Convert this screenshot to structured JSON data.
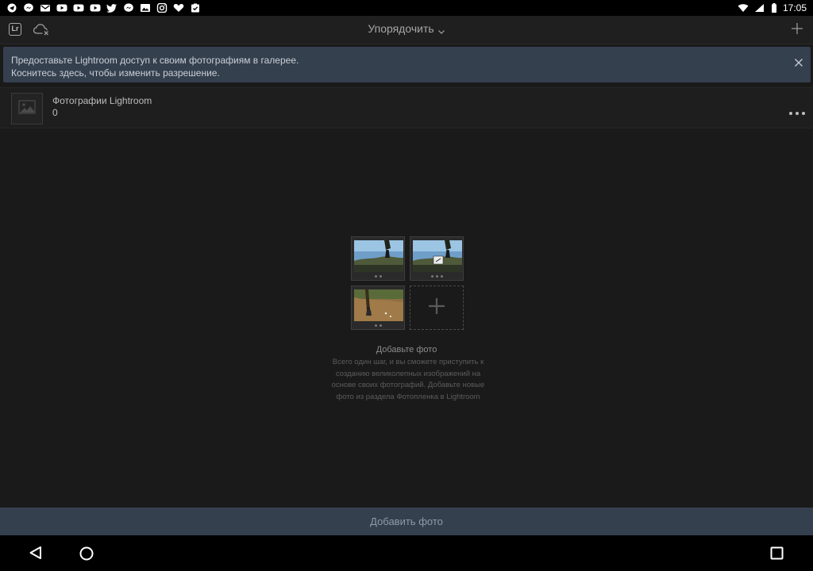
{
  "status_bar": {
    "time": "17:05",
    "left_icons": [
      "telegram-icon",
      "messenger-icon",
      "gmail-icon",
      "youtube-icon",
      "youtube-icon",
      "youtube-icon",
      "twitter-icon",
      "messenger-icon",
      "gallery-icon",
      "instagram-icon",
      "heart-icon",
      "task-icon"
    ],
    "right_icons": [
      "wifi-icon",
      "signal-icon",
      "battery-icon"
    ]
  },
  "appbar": {
    "logo_text": "Lr",
    "sort_label": "Упорядочить",
    "icons": [
      "cloud-off-icon",
      "chevron-down-icon",
      "plus-icon"
    ]
  },
  "banner": {
    "line1": "Предоставьте Lightroom доступ к своим фотографиям в галерее.",
    "line2": "Коснитесь здесь, чтобы изменить разрешение."
  },
  "album": {
    "name": "Фотографии Lightroom",
    "count": "0"
  },
  "empty_state": {
    "title": "Добавьте фото",
    "description": "Всего один шаг, и вы сможете приступить к созданию великолепных изображений на основе своих фотографий. Добавьте новые фото из раздела Фотопленка в Lightroom"
  },
  "add_button": {
    "label": "Добавить фото"
  },
  "colors": {
    "background": "#1a1a1a",
    "banner": "#35404f",
    "accent_text": "#c9ced6"
  }
}
